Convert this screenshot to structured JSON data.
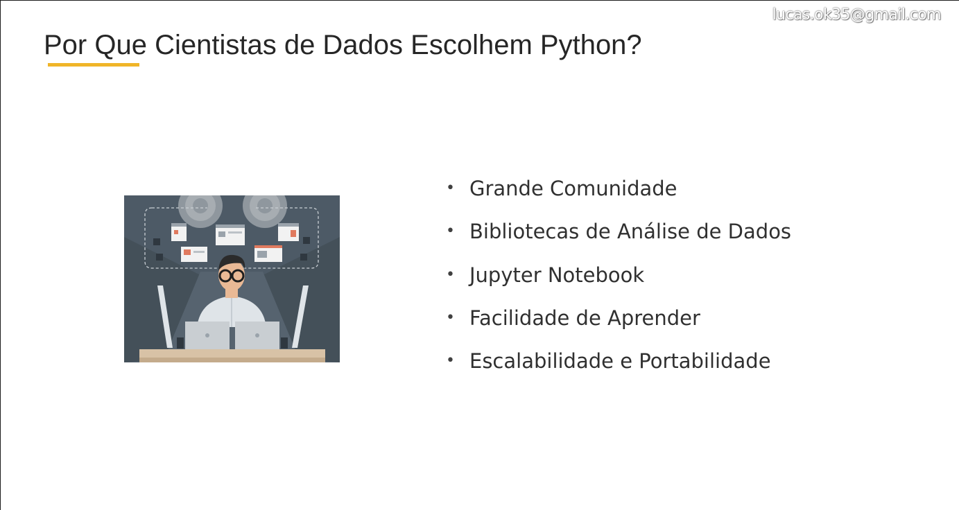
{
  "watermark": "lucas.ok35@gmail.com",
  "slide": {
    "title": "Por Que Cientistas de Dados Escolhem Python?",
    "accent_color": "#f0b528",
    "illustration": {
      "icon": "data-scientist-illustration",
      "colors": {
        "background": "#4d5a66",
        "desk": "#d8c2a6",
        "gear": "#8f979e"
      }
    },
    "bullets": [
      "Grande Comunidade",
      "Bibliotecas de Análise de Dados",
      "Jupyter Notebook",
      "Facilidade de Aprender",
      "Escalabilidade e Portabilidade"
    ]
  }
}
